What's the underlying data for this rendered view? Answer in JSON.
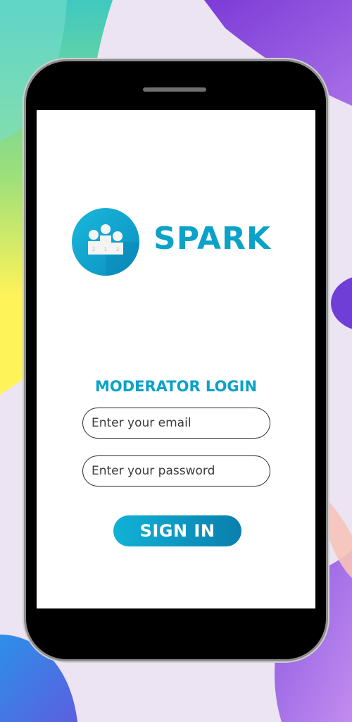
{
  "app": {
    "brand_name": "SPARK",
    "logo_icon": "podium-icon",
    "podium_numbers": [
      "2",
      "1",
      "3"
    ],
    "accent_color": "#0ba2c8"
  },
  "login": {
    "title": "MODERATOR LOGIN",
    "email_placeholder": "Enter your email",
    "password_placeholder": "Enter your password",
    "signin_label": "SIGN IN"
  }
}
